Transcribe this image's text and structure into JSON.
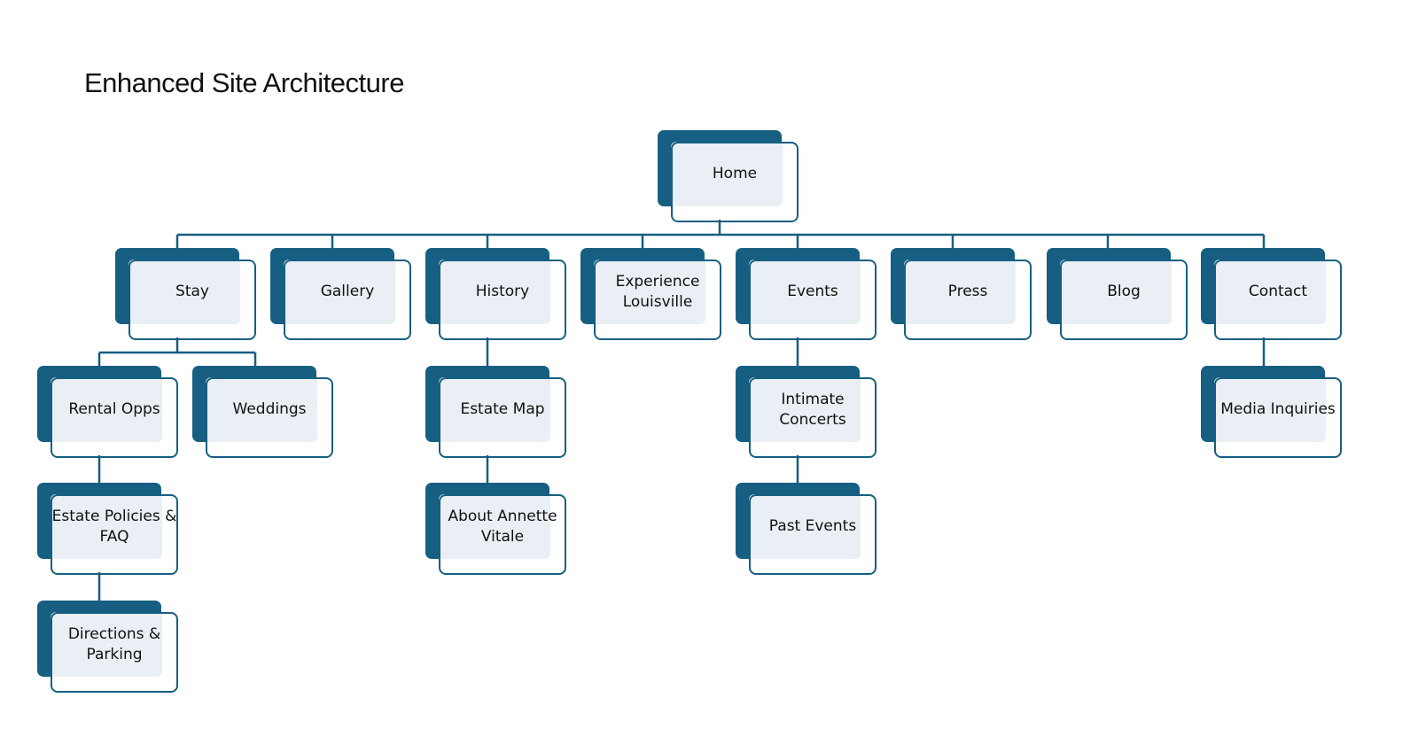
{
  "title": "Enhanced Site Architecture",
  "colors": {
    "node_dark": "#165f82",
    "node_tint": "#e8eef4",
    "connector": "#165f82"
  },
  "tree": {
    "home": "Home",
    "level1": [
      "Stay",
      "Gallery",
      "History",
      "Experience Louisville",
      "Events",
      "Press",
      "Blog",
      "Contact"
    ],
    "stay_children": [
      "Rental Opps",
      "Weddings"
    ],
    "rental_children": [
      "Estate Policies & FAQ",
      "Directions & Parking"
    ],
    "history_children": [
      "Estate Map",
      "About Annette Vitale"
    ],
    "events_children": [
      "Intimate Concerts",
      "Past Events"
    ],
    "contact_children": [
      "Media Inquiries"
    ]
  }
}
